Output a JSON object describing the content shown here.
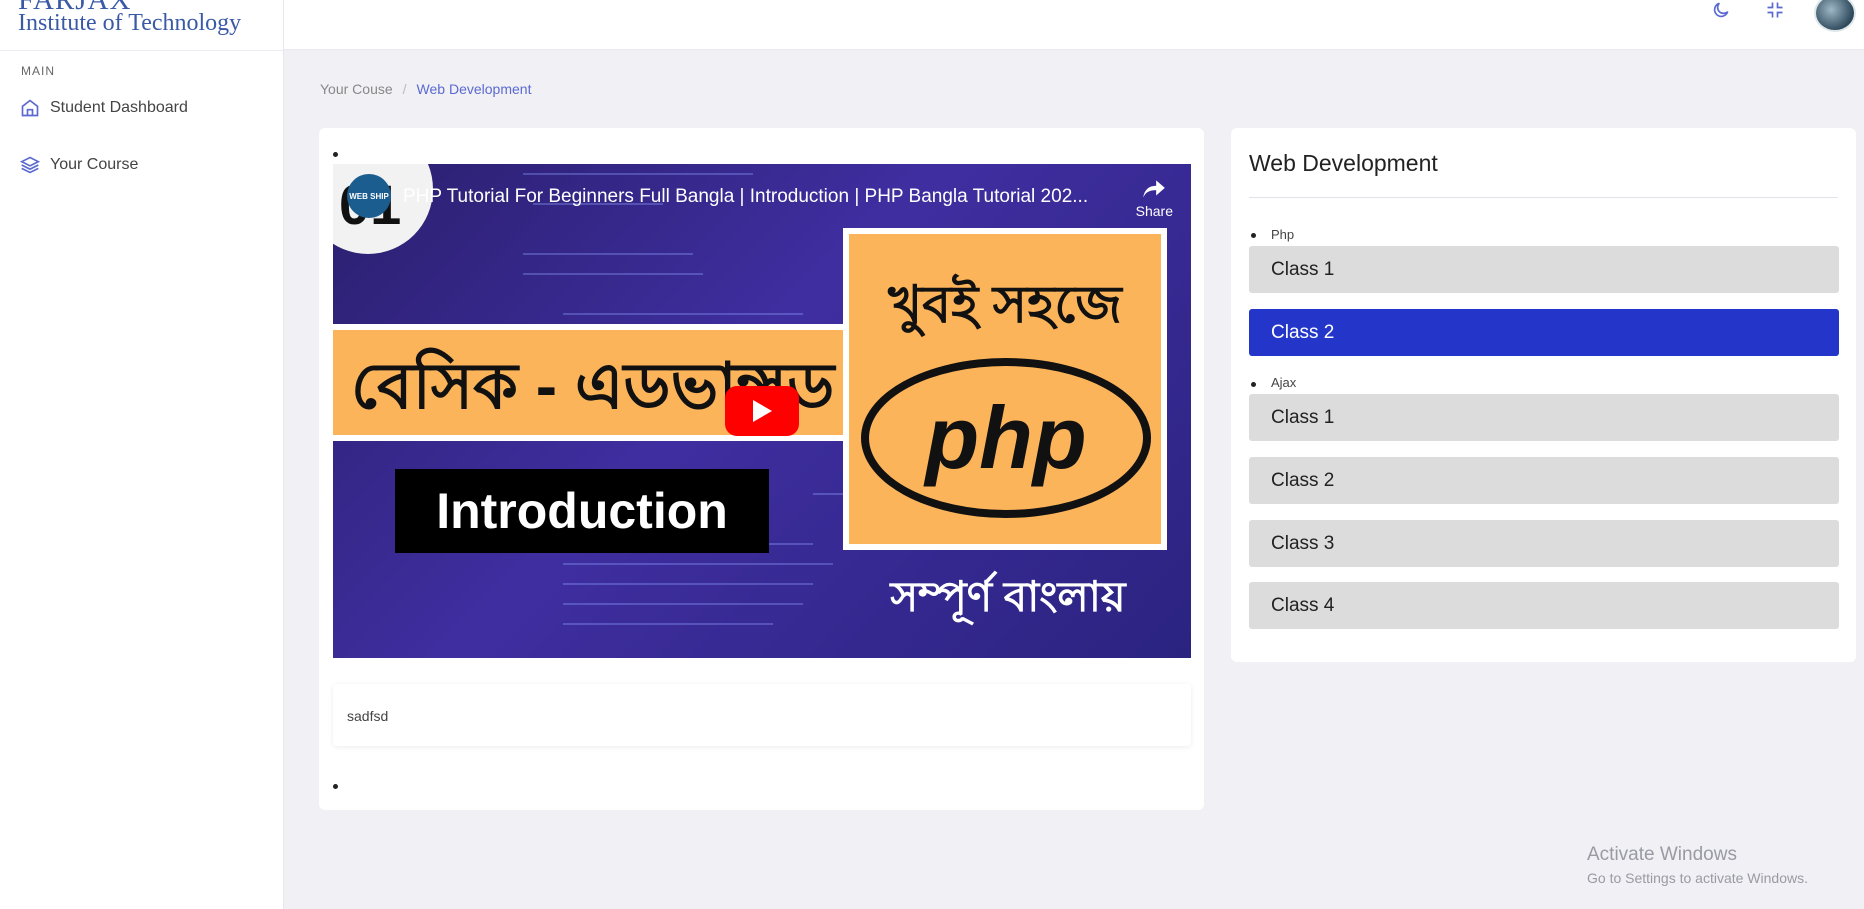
{
  "brand": {
    "line1": "FARJAX",
    "line2": "Institute of Technology"
  },
  "sidebar": {
    "section": "MAIN",
    "items": [
      {
        "label": "Student Dashboard",
        "icon": "home-icon"
      },
      {
        "label": "Your Course",
        "icon": "layers-icon"
      }
    ]
  },
  "topbar": {
    "icons": [
      "moon-icon",
      "collapse-icon",
      "avatar"
    ]
  },
  "breadcrumb": {
    "items": [
      "Your Couse",
      "Web Development"
    ],
    "separator": "/"
  },
  "video": {
    "title": "PHP Tutorial For Beginners Full Bangla | Introduction | PHP Bangla Tutorial 202...",
    "share_label": "Share",
    "channel_number": "01",
    "channel_name": "WEB SHIP",
    "thumb_left_banner": "বেসিক - এডভান্সড",
    "thumb_intro": "Introduction",
    "thumb_top_right": "খুবই সহজে",
    "thumb_logo": "php",
    "thumb_bottom_right": "সম্পূর্ণ বাংলায়"
  },
  "description": "sadfsd",
  "course_panel": {
    "title": "Web Development",
    "groups": [
      {
        "name": "Php",
        "classes": [
          "Class 1",
          "Class 2"
        ],
        "active_index": 1
      },
      {
        "name": "Ajax",
        "classes": [
          "Class 1",
          "Class 2",
          "Class 3",
          "Class 4"
        ],
        "active_index": -1
      }
    ]
  },
  "watermark": {
    "line1": "Activate Windows",
    "line2": "Go to Settings to activate Windows."
  },
  "colors": {
    "accent": "#2336c9",
    "link": "#5b6ad0",
    "thumb_orange": "#fbb45a",
    "thumb_purple": "#3f2ea0"
  }
}
